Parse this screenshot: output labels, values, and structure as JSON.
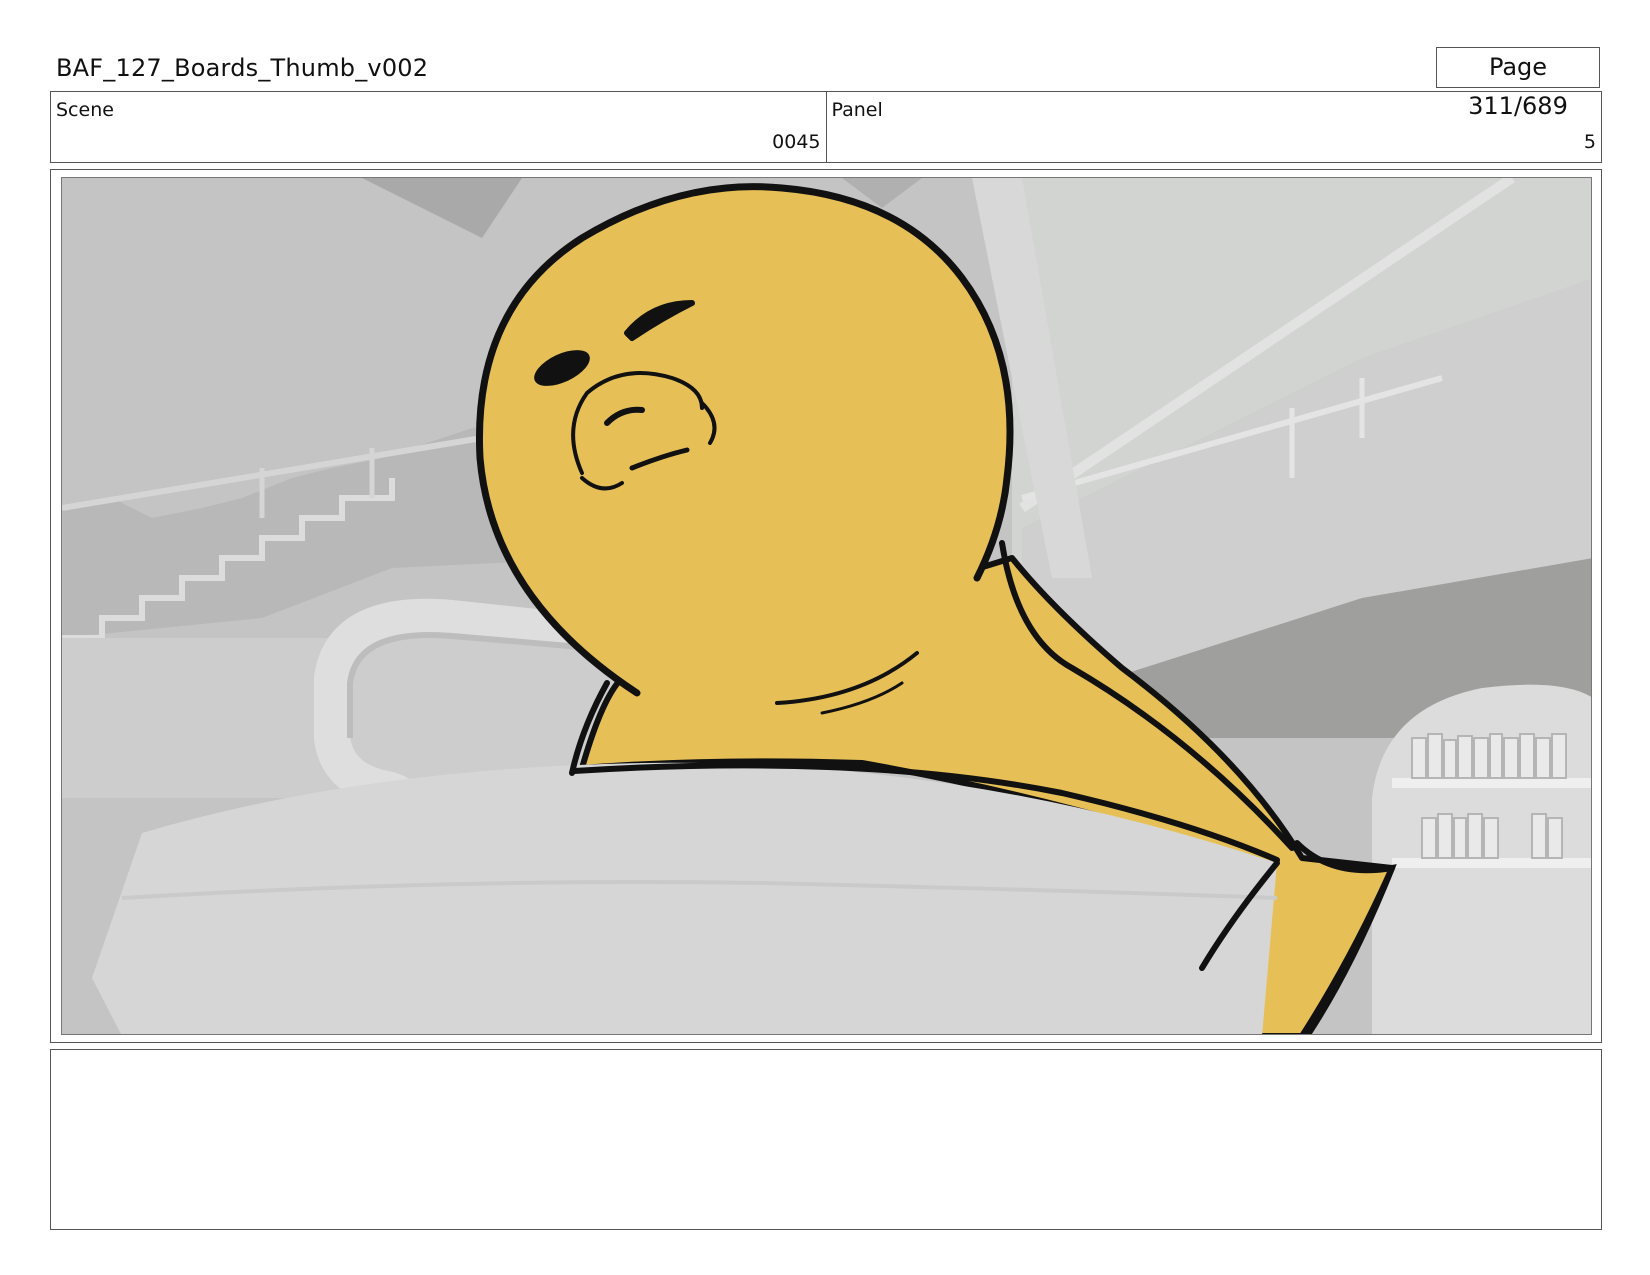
{
  "header": {
    "title": "BAF_127_Boards_Thumb_v002",
    "page": "Page 311/689"
  },
  "info": {
    "scene_label": "Scene",
    "scene_value": "0045",
    "panel_label": "Panel",
    "panel_value": "5"
  },
  "notes": {
    "text": ""
  },
  "colors": {
    "character_fill": "#e6c057",
    "outline": "#111111",
    "background_gray": "#c8c8c8",
    "border": "#555555"
  }
}
